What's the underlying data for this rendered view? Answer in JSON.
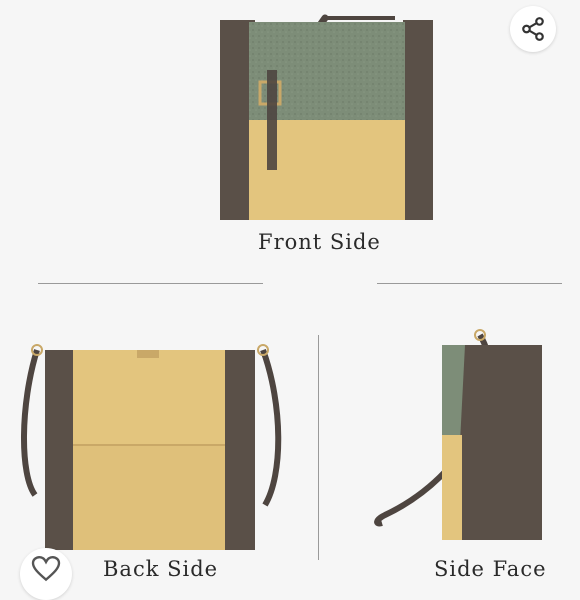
{
  "product_image": {
    "views": {
      "front": {
        "label": "Front Side"
      },
      "back": {
        "label": "Back Side"
      },
      "side": {
        "label": "Side Face"
      }
    },
    "colors": {
      "background": "#f6f6f6",
      "leather_brown": "#5a5048",
      "leather_yellow": "#e3c57e",
      "suede_green": "#7d8d78",
      "hardware_gold": "#c9a868"
    }
  },
  "controls": {
    "share_icon": "share-icon",
    "favorite_icon": "heart-icon"
  }
}
